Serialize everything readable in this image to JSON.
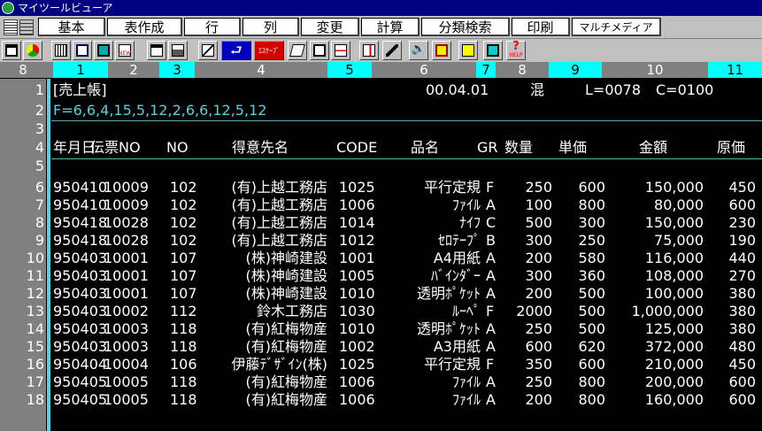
{
  "window": {
    "title": "マイツールビューア"
  },
  "menu": {
    "items": [
      "基本",
      "表作成",
      "行",
      "列",
      "変更",
      "計算",
      "分類検索",
      "印刷",
      "マルチメディア"
    ]
  },
  "toolbar": {
    "esc_label": "ｴｽｹｰﾌﾟ",
    "help_label": "HELP",
    "help_mark": "?"
  },
  "ruler": [
    "8",
    "1",
    "2",
    "3",
    "4",
    "5",
    "6",
    "7",
    "8",
    "9",
    "10",
    "11"
  ],
  "colors": {
    "ruler_bg": "#808080",
    "ruler_highlight": "#00ffff",
    "cursor_bar": "#58d0e0",
    "text": "#ffffff",
    "background": "#000000"
  },
  "sheet": {
    "row_numbers": [
      "1",
      "2",
      "3",
      "4",
      "5",
      "6",
      "7",
      "8",
      "9",
      "10",
      "11",
      "12",
      "13",
      "14",
      "15",
      "16",
      "17",
      "18"
    ],
    "info_line": {
      "title": "[売上帳]",
      "date": "00.04.01",
      "mode": "混",
      "length": "L=0078",
      "column": "C=0100"
    },
    "format_line": "F=6,6,4,15,5,12,2,6,6,12,5,12",
    "headers": [
      "年月日",
      "伝票NO",
      "NO",
      "得意先名",
      "CODE",
      "品名",
      "GR",
      "数量",
      "単価",
      "金額",
      "原価"
    ],
    "rows": [
      [
        "950410",
        "10009",
        "102",
        "(有)上越工務店",
        "1025",
        "平行定規",
        "F",
        "250",
        "600",
        "150,000",
        "450"
      ],
      [
        "950410",
        "10009",
        "102",
        "(有)上越工務店",
        "1006",
        "ﾌｧｲﾙ",
        "A",
        "100",
        "800",
        "80,000",
        "600"
      ],
      [
        "950418",
        "10028",
        "102",
        "(有)上越工務店",
        "1014",
        "ﾅｲﾌ",
        "C",
        "500",
        "300",
        "150,000",
        "230"
      ],
      [
        "950418",
        "10028",
        "102",
        "(有)上越工務店",
        "1012",
        "ｾﾛﾃｰﾌﾟ",
        "B",
        "300",
        "250",
        "75,000",
        "190"
      ],
      [
        "950403",
        "10001",
        "107",
        "(株)神崎建設",
        "1001",
        "A4用紙",
        "A",
        "200",
        "580",
        "116,000",
        "440"
      ],
      [
        "950403",
        "10001",
        "107",
        "(株)神崎建設",
        "1005",
        "ﾊﾞｲﾝﾀﾞｰ",
        "A",
        "300",
        "360",
        "108,000",
        "270"
      ],
      [
        "950403",
        "10001",
        "107",
        "(株)神崎建設",
        "1010",
        "透明ﾎﾟｹｯﾄ",
        "A",
        "200",
        "500",
        "100,000",
        "380"
      ],
      [
        "950403",
        "10002",
        "112",
        "鈴木工務店",
        "1030",
        "ﾙｰﾍﾟ",
        "F",
        "2000",
        "500",
        "1,000,000",
        "380"
      ],
      [
        "950403",
        "10003",
        "118",
        "(有)紅梅物産",
        "1010",
        "透明ﾎﾟｹｯﾄ",
        "A",
        "250",
        "500",
        "125,000",
        "380"
      ],
      [
        "950403",
        "10003",
        "118",
        "(有)紅梅物産",
        "1002",
        "A3用紙",
        "A",
        "600",
        "620",
        "372,000",
        "480"
      ],
      [
        "950404",
        "10004",
        "106",
        "伊藤ﾃﾞｻﾞｲﾝ(株)",
        "1025",
        "平行定規",
        "F",
        "350",
        "600",
        "210,000",
        "450"
      ],
      [
        "950405",
        "10005",
        "118",
        "(有)紅梅物産",
        "1006",
        "ﾌｧｲﾙ",
        "A",
        "250",
        "800",
        "200,000",
        "600"
      ],
      [
        "950405",
        "10005",
        "118",
        "(有)紅梅物産",
        "1006",
        "ﾌｧｲﾙ",
        "A",
        "200",
        "800",
        "160,000",
        "600"
      ]
    ]
  }
}
